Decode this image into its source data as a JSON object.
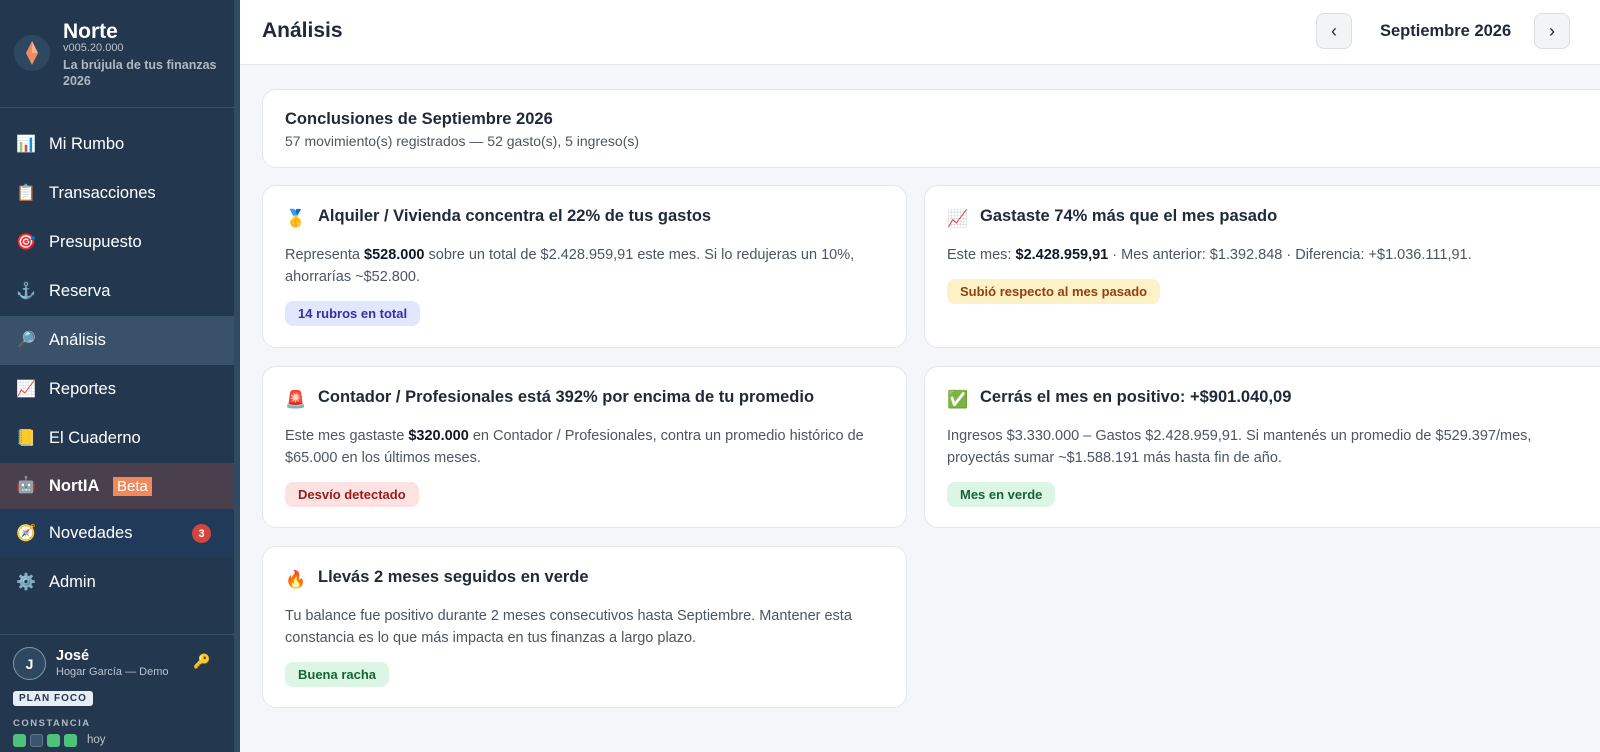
{
  "app": {
    "name": "Norte",
    "version": "v005.20.000",
    "tagline": "La brújula de tus finanzas 2026",
    "accent_color": "#f08a5d"
  },
  "sidebar": {
    "items": [
      {
        "label": "Mi Rumbo",
        "icon": "chart-icon"
      },
      {
        "label": "Transacciones",
        "icon": "clipboard-icon"
      },
      {
        "label": "Presupuesto",
        "icon": "target-icon"
      },
      {
        "label": "Reserva",
        "icon": "anchor-icon"
      },
      {
        "label": "Análisis",
        "icon": "magnifier-icon",
        "active": true
      },
      {
        "label": "Reportes",
        "icon": "trend-up-icon"
      },
      {
        "label": "El Cuaderno",
        "icon": "notebook-icon"
      },
      {
        "label": "NortIA",
        "icon": "robot-icon",
        "badge": "Beta"
      },
      {
        "label": "Novedades",
        "icon": "compass-icon",
        "count": "3"
      },
      {
        "label": "Admin",
        "icon": "gear-icon"
      }
    ]
  },
  "user": {
    "initial": "J",
    "name": "José",
    "household": "Hogar García — Demo",
    "plan": "PLAN FOCO",
    "constancia_label": "CONSTANCIA",
    "streak": [
      true,
      false,
      true,
      true
    ],
    "today_label": "hoy"
  },
  "header": {
    "title": "Análisis",
    "prev_label": "‹",
    "next_label": "›",
    "month": "Septiembre 2026"
  },
  "summary": {
    "title": "Conclusiones de Septiembre 2026",
    "subtitle": "57 movimiento(s) registrados — 52 gasto(s), 5 ingreso(s)"
  },
  "insights": {
    "rent": {
      "icon": "medal-icon",
      "title": "Alquiler / Vivienda concentra el 22% de tus gastos",
      "body_pre": "Representa ",
      "body_bold": "$528.000",
      "body_post": " sobre un total de $2.428.959,91 este mes. Si lo redujeras un 10%, ahorrarías ~$52.800.",
      "tag": "14 rubros en total"
    },
    "spent_more": {
      "icon": "chart-up-icon",
      "title": "Gastaste 74% más que el mes pasado",
      "body_pre": "Este mes: ",
      "body_bold": "$2.428.959,91",
      "body_post": " · Mes anterior: $1.392.848 · Diferencia: +$1.036.111,91.",
      "tag": "Subió respecto al mes pasado"
    },
    "accountant": {
      "icon": "siren-icon",
      "title": "Contador / Profesionales está 392% por encima de tu promedio",
      "body_pre": "Este mes gastaste ",
      "body_bold": "$320.000",
      "body_post": " en Contador / Profesionales, contra un promedio histórico de $65.000 en los últimos meses.",
      "tag": "Desvío detectado"
    },
    "positive": {
      "icon": "check-icon",
      "title": "Cerrás el mes en positivo: +$901.040,09",
      "body": "Ingresos $3.330.000 – Gastos $2.428.959,91. Si mantenés un promedio de $529.397/mes, proyectás sumar ~$1.588.191 más hasta fin de año.",
      "tag": "Mes en verde"
    },
    "streak": {
      "icon": "fire-icon",
      "title": "Llevás 2 meses seguidos en verde",
      "body": "Tu balance fue positivo durante 2 meses consecutivos hasta Septiembre. Mantener esta constancia es lo que más impacta en tus finanzas a largo plazo.",
      "tag": "Buena racha"
    }
  }
}
